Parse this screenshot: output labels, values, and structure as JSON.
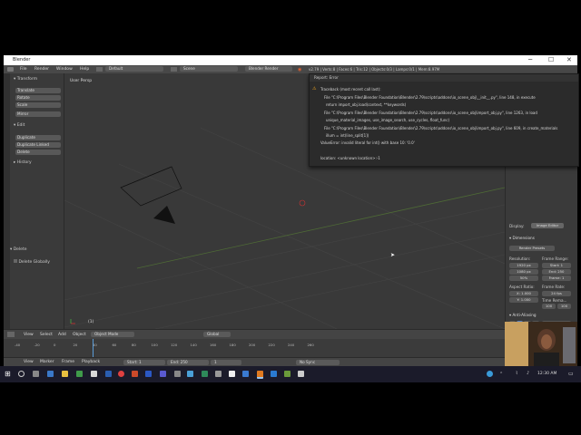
{
  "window": {
    "title": "Blender",
    "controls": [
      "─",
      "☐",
      "✕"
    ]
  },
  "infobar": {
    "menus": [
      "File",
      "Render",
      "Window",
      "Help"
    ],
    "layout": "Default",
    "scene": "Scene",
    "engine": "Blender Render",
    "stats": "v2.79 | Verts:8 | Faces:6 | Tris:12 | Objects:0/3 | Lamps:0/1 | Mem:8.97M"
  },
  "toolshelf": {
    "transform_header": "Transform",
    "transform_buttons": [
      "Translate",
      "Rotate",
      "Scale",
      "Mirror"
    ],
    "edit_header": "Edit",
    "edit_buttons": [
      "Duplicate",
      "Duplicate Linked",
      "Delete"
    ],
    "history_header": "History",
    "delete_header": "Delete",
    "delete_globally": "Delete Globally"
  },
  "viewport": {
    "label": "User Persp",
    "object_label": "(1)"
  },
  "report": {
    "header": "Report: Error",
    "lines": [
      "Traceback (most recent call last):",
      "File \"C:\\Program Files\\Blender Foundation\\Blender\\2.79\\scripts\\addons\\io_scene_obj\\__init__.py\", line 148, in execute",
      "return import_obj.load(context, **keywords)",
      "File \"C:\\Program Files\\Blender Foundation\\Blender\\2.79\\scripts\\addons\\io_scene_obj\\import_obj.py\", line 1263, in load",
      "unique_material_images, use_image_search, use_cycles, float_func)",
      "File \"C:\\Program Files\\Blender Foundation\\Blender\\2.79\\scripts\\addons\\io_scene_obj\\import_obj.py\", line 609, in create_materials",
      "illum = int(line_split[1])",
      "ValueError: invalid literal for int() with base 10: '0.0'",
      "",
      "location: <unknown location>:-1"
    ]
  },
  "properties": {
    "display_label": "Display:",
    "display_value": "Image Editor",
    "dimensions_header": "Dimensions",
    "render_presets": "Render Presets",
    "resolution_label": "Resolution:",
    "res_x": "1920 px",
    "res_y": "1080 px",
    "res_pct": "50%",
    "frame_range_label": "Frame Range:",
    "start": "Start: 1",
    "end": "End: 250",
    "frame_step": "Frame: 1",
    "aspect_label": "Aspect Ratio:",
    "aspect_x": "X: 1.000",
    "aspect_y": "Y: 1.000",
    "frame_rate_label": "Frame Rate:",
    "fps": "24 fps",
    "time_remap": "Time Rema...",
    "remap_a": "100",
    "remap_b": "100",
    "aa_header": "Anti-Aliasing",
    "aa_samples": [
      "5",
      "8",
      "11",
      "16"
    ],
    "aa_filter": "Mitchell-N",
    "full_sample": "Full Sample",
    "filter_size": "1.000 px",
    "motion_blur": "Sampled Motion Blur",
    "shading": "Shading",
    "performance": "Performance"
  },
  "header3d": {
    "menus": [
      "View",
      "Select",
      "Add",
      "Object"
    ],
    "mode": "Object Mode",
    "pivot": "Global"
  },
  "timeline": {
    "ticks": [
      "-40",
      "-20",
      "0",
      "20",
      "40",
      "60",
      "80",
      "100",
      "120",
      "140",
      "160",
      "180",
      "200",
      "220",
      "240",
      "260"
    ],
    "menus": [
      "View",
      "Marker",
      "Frame",
      "Playback"
    ],
    "start": "Start:",
    "start_val": "1",
    "end": "End:",
    "end_val": "250",
    "current": "1",
    "sync": "No Sync"
  },
  "taskbar": {
    "time": "12:30 AM"
  }
}
